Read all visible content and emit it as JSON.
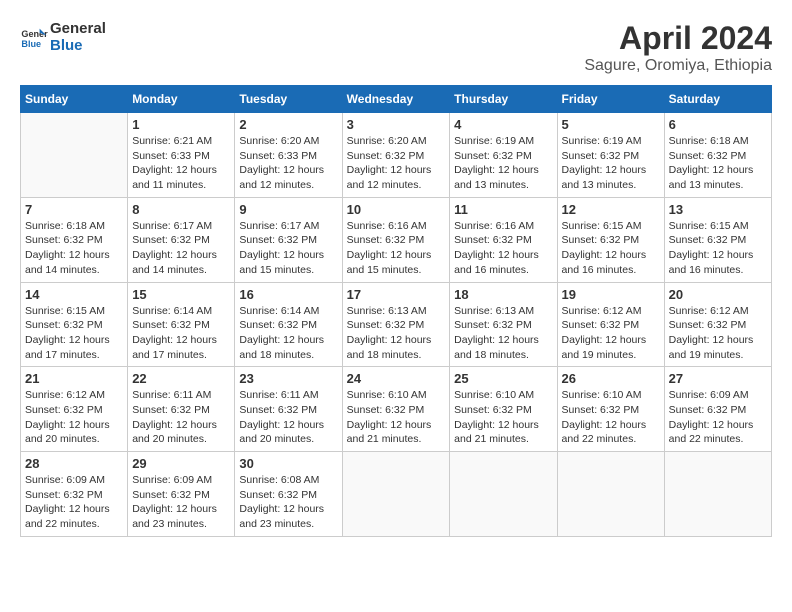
{
  "header": {
    "logo_line1": "General",
    "logo_line2": "Blue",
    "title": "April 2024",
    "subtitle": "Sagure, Oromiya, Ethiopia"
  },
  "weekdays": [
    "Sunday",
    "Monday",
    "Tuesday",
    "Wednesday",
    "Thursday",
    "Friday",
    "Saturday"
  ],
  "weeks": [
    [
      {
        "day": "",
        "sunrise": "",
        "sunset": "",
        "daylight": ""
      },
      {
        "day": "1",
        "sunrise": "Sunrise: 6:21 AM",
        "sunset": "Sunset: 6:33 PM",
        "daylight": "Daylight: 12 hours and 11 minutes."
      },
      {
        "day": "2",
        "sunrise": "Sunrise: 6:20 AM",
        "sunset": "Sunset: 6:33 PM",
        "daylight": "Daylight: 12 hours and 12 minutes."
      },
      {
        "day": "3",
        "sunrise": "Sunrise: 6:20 AM",
        "sunset": "Sunset: 6:32 PM",
        "daylight": "Daylight: 12 hours and 12 minutes."
      },
      {
        "day": "4",
        "sunrise": "Sunrise: 6:19 AM",
        "sunset": "Sunset: 6:32 PM",
        "daylight": "Daylight: 12 hours and 13 minutes."
      },
      {
        "day": "5",
        "sunrise": "Sunrise: 6:19 AM",
        "sunset": "Sunset: 6:32 PM",
        "daylight": "Daylight: 12 hours and 13 minutes."
      },
      {
        "day": "6",
        "sunrise": "Sunrise: 6:18 AM",
        "sunset": "Sunset: 6:32 PM",
        "daylight": "Daylight: 12 hours and 13 minutes."
      }
    ],
    [
      {
        "day": "7",
        "sunrise": "Sunrise: 6:18 AM",
        "sunset": "Sunset: 6:32 PM",
        "daylight": "Daylight: 12 hours and 14 minutes."
      },
      {
        "day": "8",
        "sunrise": "Sunrise: 6:17 AM",
        "sunset": "Sunset: 6:32 PM",
        "daylight": "Daylight: 12 hours and 14 minutes."
      },
      {
        "day": "9",
        "sunrise": "Sunrise: 6:17 AM",
        "sunset": "Sunset: 6:32 PM",
        "daylight": "Daylight: 12 hours and 15 minutes."
      },
      {
        "day": "10",
        "sunrise": "Sunrise: 6:16 AM",
        "sunset": "Sunset: 6:32 PM",
        "daylight": "Daylight: 12 hours and 15 minutes."
      },
      {
        "day": "11",
        "sunrise": "Sunrise: 6:16 AM",
        "sunset": "Sunset: 6:32 PM",
        "daylight": "Daylight: 12 hours and 16 minutes."
      },
      {
        "day": "12",
        "sunrise": "Sunrise: 6:15 AM",
        "sunset": "Sunset: 6:32 PM",
        "daylight": "Daylight: 12 hours and 16 minutes."
      },
      {
        "day": "13",
        "sunrise": "Sunrise: 6:15 AM",
        "sunset": "Sunset: 6:32 PM",
        "daylight": "Daylight: 12 hours and 16 minutes."
      }
    ],
    [
      {
        "day": "14",
        "sunrise": "Sunrise: 6:15 AM",
        "sunset": "Sunset: 6:32 PM",
        "daylight": "Daylight: 12 hours and 17 minutes."
      },
      {
        "day": "15",
        "sunrise": "Sunrise: 6:14 AM",
        "sunset": "Sunset: 6:32 PM",
        "daylight": "Daylight: 12 hours and 17 minutes."
      },
      {
        "day": "16",
        "sunrise": "Sunrise: 6:14 AM",
        "sunset": "Sunset: 6:32 PM",
        "daylight": "Daylight: 12 hours and 18 minutes."
      },
      {
        "day": "17",
        "sunrise": "Sunrise: 6:13 AM",
        "sunset": "Sunset: 6:32 PM",
        "daylight": "Daylight: 12 hours and 18 minutes."
      },
      {
        "day": "18",
        "sunrise": "Sunrise: 6:13 AM",
        "sunset": "Sunset: 6:32 PM",
        "daylight": "Daylight: 12 hours and 18 minutes."
      },
      {
        "day": "19",
        "sunrise": "Sunrise: 6:12 AM",
        "sunset": "Sunset: 6:32 PM",
        "daylight": "Daylight: 12 hours and 19 minutes."
      },
      {
        "day": "20",
        "sunrise": "Sunrise: 6:12 AM",
        "sunset": "Sunset: 6:32 PM",
        "daylight": "Daylight: 12 hours and 19 minutes."
      }
    ],
    [
      {
        "day": "21",
        "sunrise": "Sunrise: 6:12 AM",
        "sunset": "Sunset: 6:32 PM",
        "daylight": "Daylight: 12 hours and 20 minutes."
      },
      {
        "day": "22",
        "sunrise": "Sunrise: 6:11 AM",
        "sunset": "Sunset: 6:32 PM",
        "daylight": "Daylight: 12 hours and 20 minutes."
      },
      {
        "day": "23",
        "sunrise": "Sunrise: 6:11 AM",
        "sunset": "Sunset: 6:32 PM",
        "daylight": "Daylight: 12 hours and 20 minutes."
      },
      {
        "day": "24",
        "sunrise": "Sunrise: 6:10 AM",
        "sunset": "Sunset: 6:32 PM",
        "daylight": "Daylight: 12 hours and 21 minutes."
      },
      {
        "day": "25",
        "sunrise": "Sunrise: 6:10 AM",
        "sunset": "Sunset: 6:32 PM",
        "daylight": "Daylight: 12 hours and 21 minutes."
      },
      {
        "day": "26",
        "sunrise": "Sunrise: 6:10 AM",
        "sunset": "Sunset: 6:32 PM",
        "daylight": "Daylight: 12 hours and 22 minutes."
      },
      {
        "day": "27",
        "sunrise": "Sunrise: 6:09 AM",
        "sunset": "Sunset: 6:32 PM",
        "daylight": "Daylight: 12 hours and 22 minutes."
      }
    ],
    [
      {
        "day": "28",
        "sunrise": "Sunrise: 6:09 AM",
        "sunset": "Sunset: 6:32 PM",
        "daylight": "Daylight: 12 hours and 22 minutes."
      },
      {
        "day": "29",
        "sunrise": "Sunrise: 6:09 AM",
        "sunset": "Sunset: 6:32 PM",
        "daylight": "Daylight: 12 hours and 23 minutes."
      },
      {
        "day": "30",
        "sunrise": "Sunrise: 6:08 AM",
        "sunset": "Sunset: 6:32 PM",
        "daylight": "Daylight: 12 hours and 23 minutes."
      },
      {
        "day": "",
        "sunrise": "",
        "sunset": "",
        "daylight": ""
      },
      {
        "day": "",
        "sunrise": "",
        "sunset": "",
        "daylight": ""
      },
      {
        "day": "",
        "sunrise": "",
        "sunset": "",
        "daylight": ""
      },
      {
        "day": "",
        "sunrise": "",
        "sunset": "",
        "daylight": ""
      }
    ]
  ]
}
